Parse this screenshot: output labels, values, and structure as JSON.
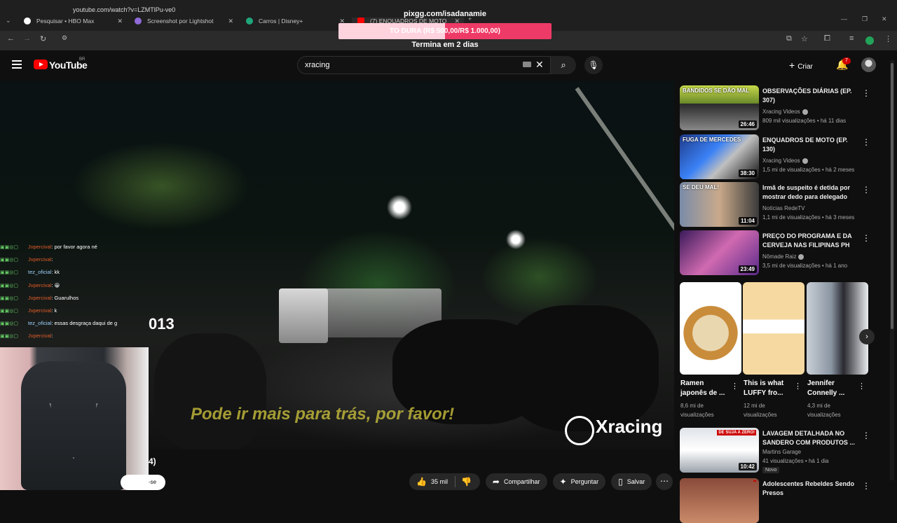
{
  "browser": {
    "tabs": [
      {
        "label": "Pesquisar • HBO Max",
        "color": "#ffffff"
      },
      {
        "label": "Screenshot por Lightshot",
        "color": "#8f6ad8"
      },
      {
        "label": "Carros | Disney+",
        "color": "#1fa67a"
      },
      {
        "label": "(7) ENQUADROS DE MOTO",
        "color": "#ff0000"
      }
    ],
    "url": "youtube.com/watch?v=LZMTlPu-ve0"
  },
  "stream_overlay": {
    "top_link": "pixgg.com/isadanamie",
    "goal_text": "TO DURA (R$ 500,00/R$ 1.000,00)",
    "goal_progress": 0.5,
    "goal_color": "#ee3a66",
    "sub_text": "Termina em 2 dias"
  },
  "youtube": {
    "logo_text": "YouTube",
    "region": "BR",
    "search_value": "xracing",
    "create_label": "Criar",
    "notif_count": "7"
  },
  "video": {
    "caption": "Pode ir mais para trás, por favor!",
    "watermark": "Xracing",
    "partial_left": "013",
    "partial_bottom": "4)",
    "subscribe_partial": "-se"
  },
  "actions": {
    "likes": "35 mil",
    "share": "Compartilhar",
    "ask": "Perguntar",
    "save": "Salvar"
  },
  "chat": [
    {
      "user": "Jvpercival",
      "msg": "por favor agora né",
      "blue": false
    },
    {
      "user": "Jvpercival",
      "msg": "",
      "blue": false
    },
    {
      "user": "tez_oficial",
      "msg": "kk",
      "blue": true
    },
    {
      "user": "Jvpercival",
      "msg": "😀",
      "blue": false
    },
    {
      "user": "Jvpercival",
      "msg": "Guarulhos",
      "blue": false
    },
    {
      "user": "Jvpercival",
      "msg": "k",
      "blue": false
    },
    {
      "user": "tez_oficial",
      "msg": "essas desgraça daqui de g",
      "blue": true
    },
    {
      "user": "Jvpercival",
      "msg": "",
      "blue": false
    }
  ],
  "recommendations": [
    {
      "title": "OBSERVAÇÕES DIÁRIAS (EP. 307)",
      "channel": "Xracing Videos",
      "meta": "809 mil visualizações • há 11 dias",
      "duration": "26:46",
      "thumb_text": "BANDIDOS SE DÃO MAL",
      "verified": true
    },
    {
      "title": "ENQUADROS DE MOTO (EP. 130)",
      "channel": "Xracing Videos",
      "meta": "1,5 mi de visualizações • há 2 meses",
      "duration": "38:30",
      "thumb_text": "FUGA DE MERCEDES",
      "verified": true
    },
    {
      "title": "Irmã de suspeito é detida por mostrar dedo para delegado",
      "channel": "Notícias RedeTV",
      "meta": "1,1 mi de visualizações • há 3 meses",
      "duration": "11:04",
      "thumb_text": "SE DEU MAL!",
      "verified": false
    },
    {
      "title": "PREÇO DO PROGRAMA E DA CERVEJA NAS FILIPINAS PH",
      "channel": "Nômade Raiz",
      "meta": "3,5 mi de visualizações • há 1 ano",
      "duration": "23:49",
      "thumb_text": "",
      "verified": true
    }
  ],
  "shorts": [
    {
      "title": "Ramen japonês de ...",
      "views": "8,6 mi de visualizações"
    },
    {
      "title": "This is what LUFFY fro...",
      "views": "12 mi de visualizações"
    },
    {
      "title": "Jennifer Connelly ...",
      "views": "4,3 mi de visualizações"
    }
  ],
  "more_recs": [
    {
      "title": "LAVAGEM DETALHADA NO SANDERO COM PRODUTOS ...",
      "channel": "Martins Garage",
      "meta": "41 visualizações • há 1 dia",
      "duration": "10:42",
      "thumb_text": "DE SUJA A ZERO!",
      "badge": "Novo"
    },
    {
      "title": "Adolescentes Rebeldes Sendo Presos",
      "channel": "",
      "meta": "",
      "duration": "",
      "thumb_text": ""
    }
  ]
}
